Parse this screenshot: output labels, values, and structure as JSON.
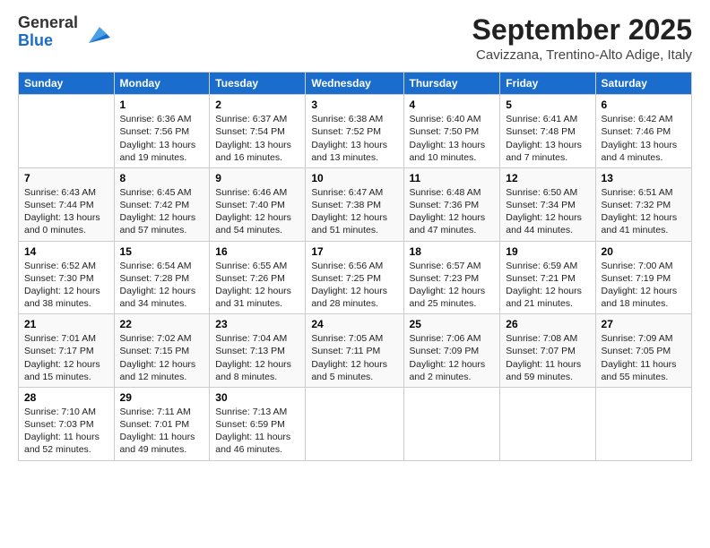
{
  "logo": {
    "general": "General",
    "blue": "Blue"
  },
  "header": {
    "month": "September 2025",
    "location": "Cavizzana, Trentino-Alto Adige, Italy"
  },
  "weekdays": [
    "Sunday",
    "Monday",
    "Tuesday",
    "Wednesday",
    "Thursday",
    "Friday",
    "Saturday"
  ],
  "weeks": [
    [
      {
        "day": "",
        "info": ""
      },
      {
        "day": "1",
        "info": "Sunrise: 6:36 AM\nSunset: 7:56 PM\nDaylight: 13 hours\nand 19 minutes."
      },
      {
        "day": "2",
        "info": "Sunrise: 6:37 AM\nSunset: 7:54 PM\nDaylight: 13 hours\nand 16 minutes."
      },
      {
        "day": "3",
        "info": "Sunrise: 6:38 AM\nSunset: 7:52 PM\nDaylight: 13 hours\nand 13 minutes."
      },
      {
        "day": "4",
        "info": "Sunrise: 6:40 AM\nSunset: 7:50 PM\nDaylight: 13 hours\nand 10 minutes."
      },
      {
        "day": "5",
        "info": "Sunrise: 6:41 AM\nSunset: 7:48 PM\nDaylight: 13 hours\nand 7 minutes."
      },
      {
        "day": "6",
        "info": "Sunrise: 6:42 AM\nSunset: 7:46 PM\nDaylight: 13 hours\nand 4 minutes."
      }
    ],
    [
      {
        "day": "7",
        "info": "Sunrise: 6:43 AM\nSunset: 7:44 PM\nDaylight: 13 hours\nand 0 minutes."
      },
      {
        "day": "8",
        "info": "Sunrise: 6:45 AM\nSunset: 7:42 PM\nDaylight: 12 hours\nand 57 minutes."
      },
      {
        "day": "9",
        "info": "Sunrise: 6:46 AM\nSunset: 7:40 PM\nDaylight: 12 hours\nand 54 minutes."
      },
      {
        "day": "10",
        "info": "Sunrise: 6:47 AM\nSunset: 7:38 PM\nDaylight: 12 hours\nand 51 minutes."
      },
      {
        "day": "11",
        "info": "Sunrise: 6:48 AM\nSunset: 7:36 PM\nDaylight: 12 hours\nand 47 minutes."
      },
      {
        "day": "12",
        "info": "Sunrise: 6:50 AM\nSunset: 7:34 PM\nDaylight: 12 hours\nand 44 minutes."
      },
      {
        "day": "13",
        "info": "Sunrise: 6:51 AM\nSunset: 7:32 PM\nDaylight: 12 hours\nand 41 minutes."
      }
    ],
    [
      {
        "day": "14",
        "info": "Sunrise: 6:52 AM\nSunset: 7:30 PM\nDaylight: 12 hours\nand 38 minutes."
      },
      {
        "day": "15",
        "info": "Sunrise: 6:54 AM\nSunset: 7:28 PM\nDaylight: 12 hours\nand 34 minutes."
      },
      {
        "day": "16",
        "info": "Sunrise: 6:55 AM\nSunset: 7:26 PM\nDaylight: 12 hours\nand 31 minutes."
      },
      {
        "day": "17",
        "info": "Sunrise: 6:56 AM\nSunset: 7:25 PM\nDaylight: 12 hours\nand 28 minutes."
      },
      {
        "day": "18",
        "info": "Sunrise: 6:57 AM\nSunset: 7:23 PM\nDaylight: 12 hours\nand 25 minutes."
      },
      {
        "day": "19",
        "info": "Sunrise: 6:59 AM\nSunset: 7:21 PM\nDaylight: 12 hours\nand 21 minutes."
      },
      {
        "day": "20",
        "info": "Sunrise: 7:00 AM\nSunset: 7:19 PM\nDaylight: 12 hours\nand 18 minutes."
      }
    ],
    [
      {
        "day": "21",
        "info": "Sunrise: 7:01 AM\nSunset: 7:17 PM\nDaylight: 12 hours\nand 15 minutes."
      },
      {
        "day": "22",
        "info": "Sunrise: 7:02 AM\nSunset: 7:15 PM\nDaylight: 12 hours\nand 12 minutes."
      },
      {
        "day": "23",
        "info": "Sunrise: 7:04 AM\nSunset: 7:13 PM\nDaylight: 12 hours\nand 8 minutes."
      },
      {
        "day": "24",
        "info": "Sunrise: 7:05 AM\nSunset: 7:11 PM\nDaylight: 12 hours\nand 5 minutes."
      },
      {
        "day": "25",
        "info": "Sunrise: 7:06 AM\nSunset: 7:09 PM\nDaylight: 12 hours\nand 2 minutes."
      },
      {
        "day": "26",
        "info": "Sunrise: 7:08 AM\nSunset: 7:07 PM\nDaylight: 11 hours\nand 59 minutes."
      },
      {
        "day": "27",
        "info": "Sunrise: 7:09 AM\nSunset: 7:05 PM\nDaylight: 11 hours\nand 55 minutes."
      }
    ],
    [
      {
        "day": "28",
        "info": "Sunrise: 7:10 AM\nSunset: 7:03 PM\nDaylight: 11 hours\nand 52 minutes."
      },
      {
        "day": "29",
        "info": "Sunrise: 7:11 AM\nSunset: 7:01 PM\nDaylight: 11 hours\nand 49 minutes."
      },
      {
        "day": "30",
        "info": "Sunrise: 7:13 AM\nSunset: 6:59 PM\nDaylight: 11 hours\nand 46 minutes."
      },
      {
        "day": "",
        "info": ""
      },
      {
        "day": "",
        "info": ""
      },
      {
        "day": "",
        "info": ""
      },
      {
        "day": "",
        "info": ""
      }
    ]
  ]
}
